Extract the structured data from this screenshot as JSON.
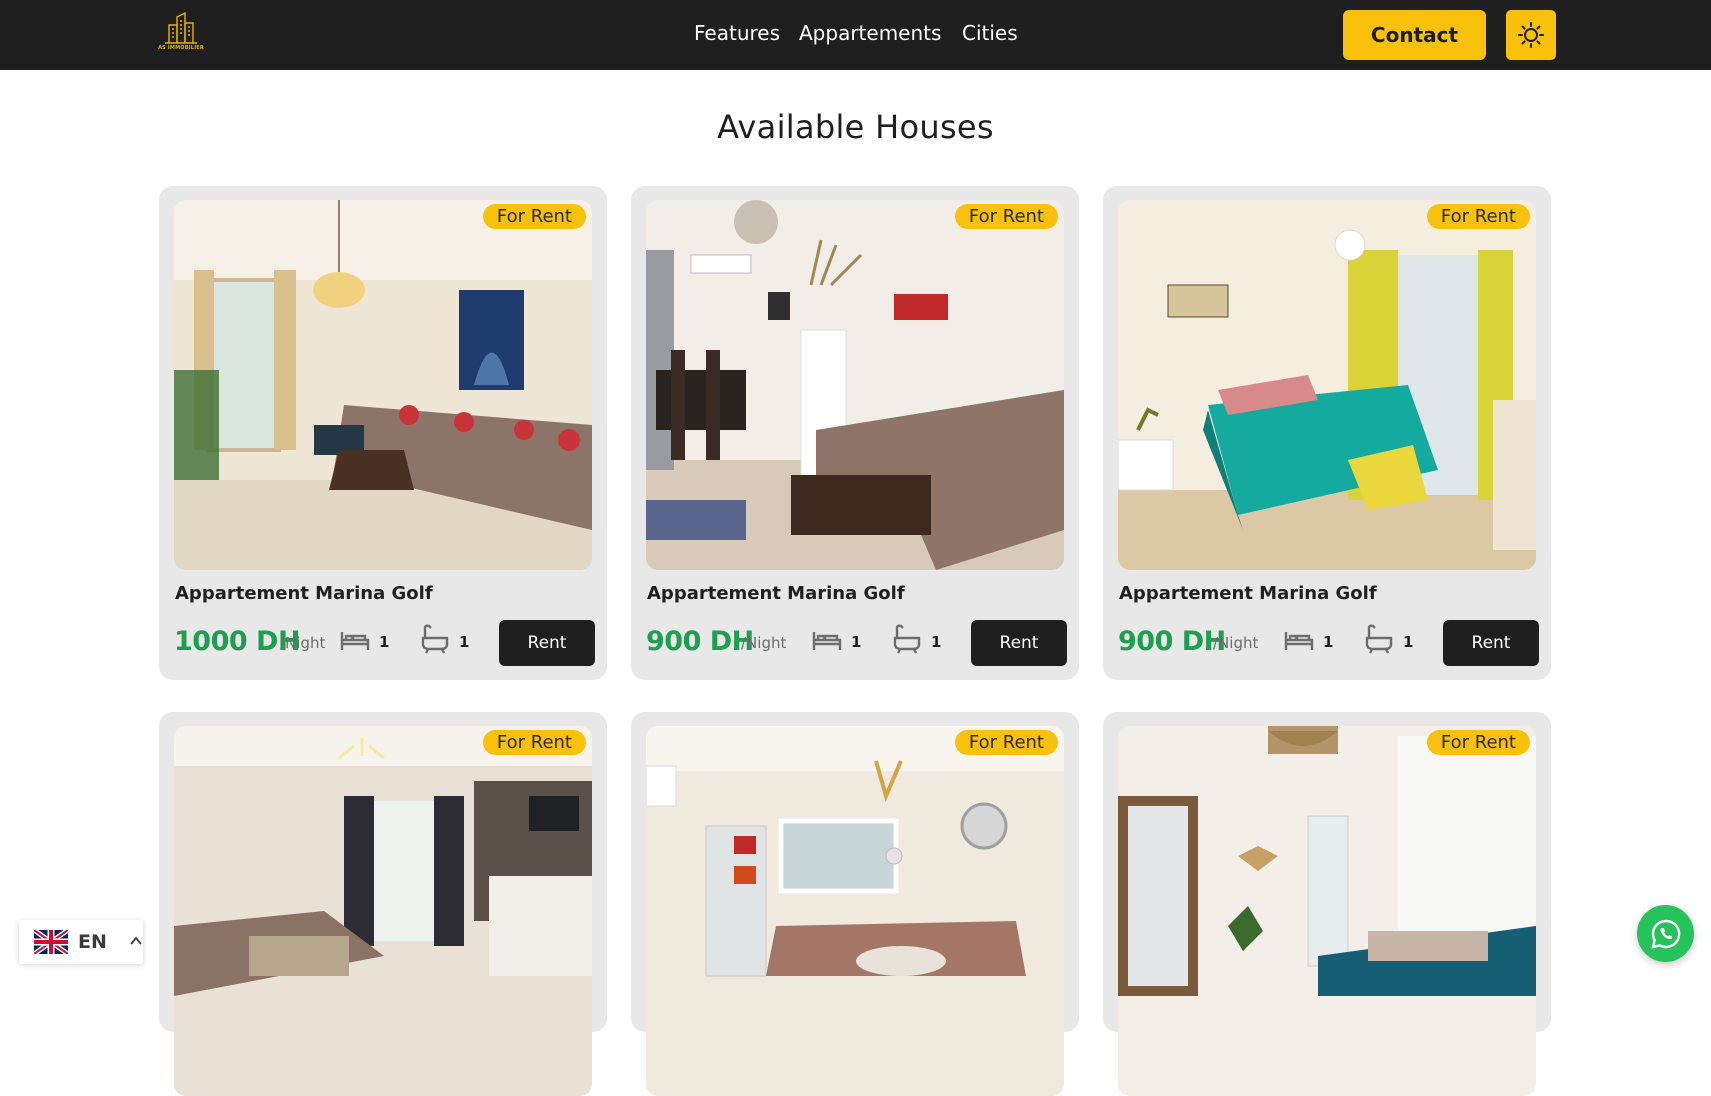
{
  "header": {
    "logo_text": "AS IMMOBILIER",
    "nav": [
      "Features",
      "Appartements",
      "Cities"
    ],
    "contact_label": "Contact",
    "theme_icon": "sun-icon",
    "accent": "#f9c10b",
    "background": "#1f1f1f"
  },
  "main": {
    "title": "Available Houses",
    "cards": [
      {
        "badge": "For Rent",
        "title": "Appartement Marina Golf",
        "price": "1000 DH",
        "per": "/Night",
        "beds": "1",
        "baths": "1",
        "rent_label": "Rent"
      },
      {
        "badge": "For Rent",
        "title": "Appartement Marina Golf",
        "price": "900 DH",
        "per": "/Night",
        "beds": "1",
        "baths": "1",
        "rent_label": "Rent"
      },
      {
        "badge": "For Rent",
        "title": "Appartement Marina Golf",
        "price": "900 DH",
        "per": "/Night",
        "beds": "1",
        "baths": "1",
        "rent_label": "Rent"
      },
      {
        "badge": "For Rent"
      },
      {
        "badge": "For Rent"
      },
      {
        "badge": "For Rent"
      }
    ],
    "price_color": "#1e9e4f"
  },
  "language": {
    "label": "EN",
    "flag_icon": "uk-flag-icon"
  },
  "whatsapp": {
    "icon": "whatsapp-icon",
    "color": "#27c25c"
  }
}
